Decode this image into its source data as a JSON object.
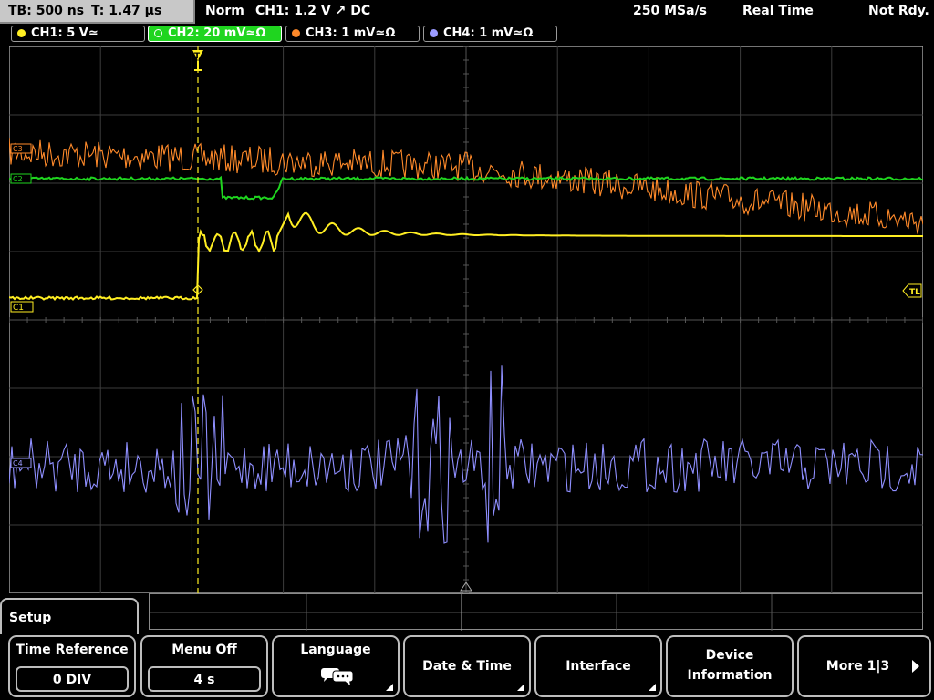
{
  "header": {
    "timebase": "TB: 500 ns",
    "trigger_time": "T: 1.47 µs",
    "mode": "Norm",
    "trigger_info": "CH1: 1.2 V ↗ DC",
    "sample_rate": "250 MSa/s",
    "acq_mode": "Real Time",
    "status": "Not Rdy."
  },
  "channels": [
    {
      "label": "CH1: 5 V≃",
      "color": "#ffee22",
      "active": false
    },
    {
      "label": "CH2: 20 mV≃Ω",
      "color": "#1fd51f",
      "active": true
    },
    {
      "label": "CH3: 1 mV≃Ω",
      "color": "#ff8a2a",
      "active": false
    },
    {
      "label": "CH4: 1 mV≃Ω",
      "color": "#9a9aff",
      "active": false
    }
  ],
  "markers": {
    "trigger": "T",
    "ch1": "C1",
    "ch2": "C2",
    "ch3": "C3",
    "ch4": "C4",
    "trigger_level": "TL"
  },
  "menu": {
    "title": "Setup",
    "softkeys": [
      {
        "label": "Time Reference",
        "value": "0 DIV"
      },
      {
        "label": "Menu Off",
        "value": "4 s"
      },
      {
        "label": "Language",
        "icon": "speech-bubble-icon"
      },
      {
        "label": "Date & Time"
      },
      {
        "label": "Interface"
      },
      {
        "label_line1": "Device",
        "label_line2": "Information"
      },
      {
        "label": "More 1|3",
        "icon": "right-arrow-icon"
      }
    ]
  }
}
